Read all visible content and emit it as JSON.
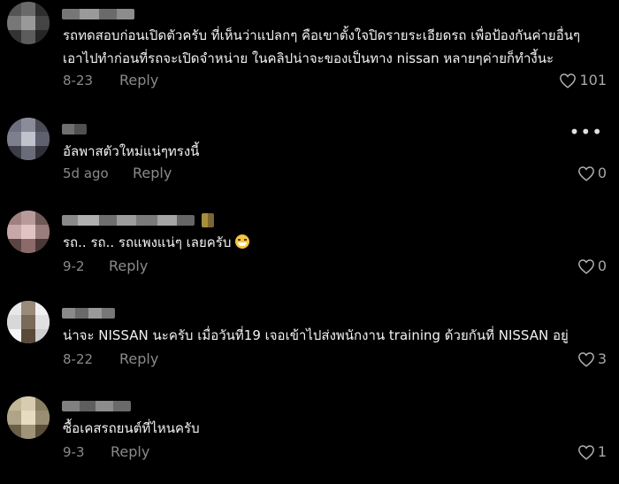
{
  "comments": [
    {
      "text_line1": "รถทดสอบก่อนเปิดตัวครับ ที่เห็นว่าแปลกๆ คือเขาตั้งใจปิดรายระเอียดรถ เพื่อป้องกันค่ายอื่นๆ",
      "text_line2": "เอาไปทำก่อนที่รถจะเปิดจำหน่าย ในคลิปน่าจะของเป็นทาง nissan หลายๆค่ายก็ทำงี้นะ",
      "date": "8-23",
      "reply_label": "Reply",
      "likes": "101"
    },
    {
      "text_line1": "อัลพาสตัวใหม่แน่ๆทรงนี้",
      "date": "5d ago",
      "reply_label": "Reply",
      "likes": "0"
    },
    {
      "text_line1": "รถ.. รถ.. รถแพงแน่ๆ เลยครับ",
      "date": "9-2",
      "reply_label": "Reply",
      "likes": "0"
    },
    {
      "text_line1": "น่าจะ NISSAN นะครับ เมื่อวันที่19 เจอเข้าไปส่งพนักงาน training ด้วยกันที่ NISSAN อยู่",
      "date": "8-22",
      "reply_label": "Reply",
      "likes": "3"
    },
    {
      "text_line1": "ซื้อเคสรถยนต์ที่ไหนครับ",
      "date": "9-3",
      "reply_label": "Reply",
      "likes": "1"
    }
  ],
  "icons": {
    "like": "heart-outline-icon",
    "more": "more-options-icon",
    "emoji": "grinning-sweat-emoji"
  },
  "colors": {
    "background": "#000000",
    "text": "#f2f2f2",
    "muted": "#8a8a8a"
  }
}
